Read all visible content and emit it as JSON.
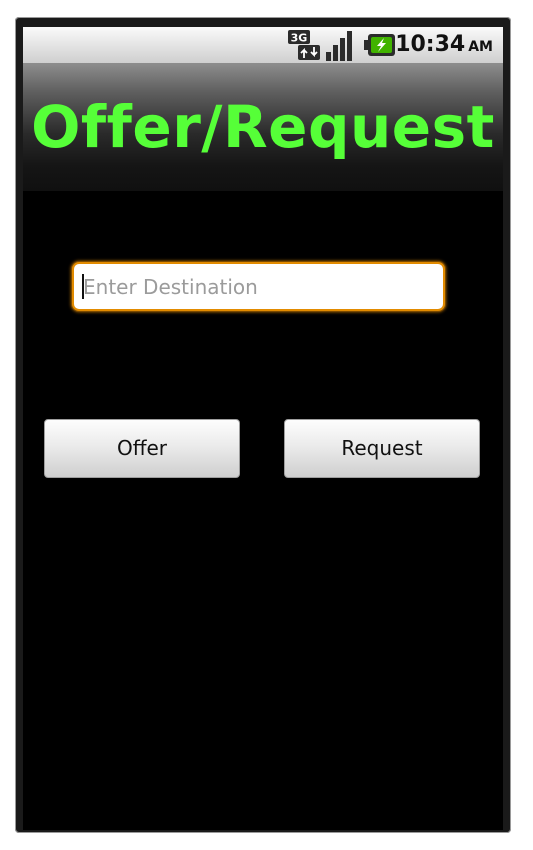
{
  "status_bar": {
    "time": "10:34",
    "ampm": "AM",
    "icons": [
      "3g-data-icon",
      "signal-strength-icon",
      "battery-charging-icon"
    ]
  },
  "header": {
    "title": "Offer/Request",
    "title_color": "#56ff38"
  },
  "form": {
    "destination": {
      "value": "",
      "placeholder": "Enter Destination",
      "focus_color": "#e28b00"
    },
    "buttons": {
      "offer_label": "Offer",
      "request_label": "Request"
    }
  }
}
